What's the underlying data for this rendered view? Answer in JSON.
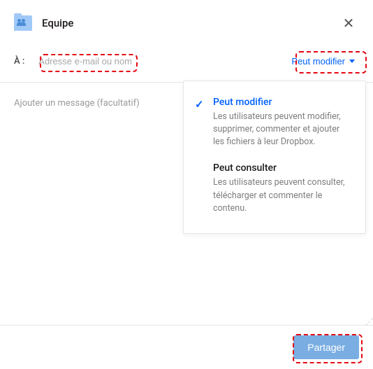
{
  "header": {
    "title": "Equipe",
    "close_label": "✕"
  },
  "to": {
    "label": "À :",
    "placeholder": "Adresse e-mail ou nom"
  },
  "permission": {
    "selected_label": "Peut modifier",
    "options": [
      {
        "title": "Peut modifier",
        "desc": "Les utilisateurs peuvent modifier, supprimer, commenter et ajouter les fichiers à leur Dropbox.",
        "selected": true
      },
      {
        "title": "Peut consulter",
        "desc": "Les utilisateurs peuvent consulter, télécharger et commenter le contenu.",
        "selected": false
      }
    ]
  },
  "message": {
    "placeholder": "Ajouter un message (facultatif)"
  },
  "footer": {
    "share_label": "Partager"
  }
}
